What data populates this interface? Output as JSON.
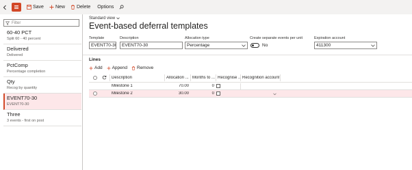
{
  "toolbar": {
    "save_label": "Save",
    "new_label": "New",
    "delete_label": "Delete",
    "options_label": "Options"
  },
  "filter": {
    "placeholder": "Filter"
  },
  "list": {
    "items": [
      {
        "title": "60-40 PCT",
        "subtitle": "Split 60 - 40 percent"
      },
      {
        "title": "Delivered",
        "subtitle": "Delivered"
      },
      {
        "title": "PctComp",
        "subtitle": "Percentage completion"
      },
      {
        "title": "Qty",
        "subtitle": "Recog by quantity"
      },
      {
        "title": "EVENT70-30",
        "subtitle": "EVENT70-30"
      },
      {
        "title": "Three",
        "subtitle": "3 events - first on post"
      }
    ]
  },
  "header": {
    "view_label": "Standard view",
    "title": "Event-based deferral templates"
  },
  "form": {
    "template_label": "Template",
    "template_value": "EVENT70-30",
    "description_label": "Description",
    "description_value": "EVENT70-30",
    "allocation_label": "Allocation type",
    "allocation_value": "Percentage",
    "separate_label": "Create separate events per unit",
    "separate_value": "No",
    "expiration_label": "Expiration account",
    "expiration_value": "411300"
  },
  "lines": {
    "title": "Lines",
    "add_label": "Add",
    "append_label": "Append",
    "remove_label": "Remove",
    "columns": {
      "description": "Description",
      "allocation": "Allocation ...",
      "months": "Months to ...",
      "recognise": "Recognise ...",
      "account": "Recognition account"
    },
    "rows": [
      {
        "description": "Milestone 1",
        "allocation": "70.00",
        "months": "0"
      },
      {
        "description": "Milestone 2",
        "allocation": "30.00",
        "months": "0"
      }
    ]
  },
  "colors": {
    "accent": "#d24726",
    "selected_bg": "#fde7e9"
  }
}
